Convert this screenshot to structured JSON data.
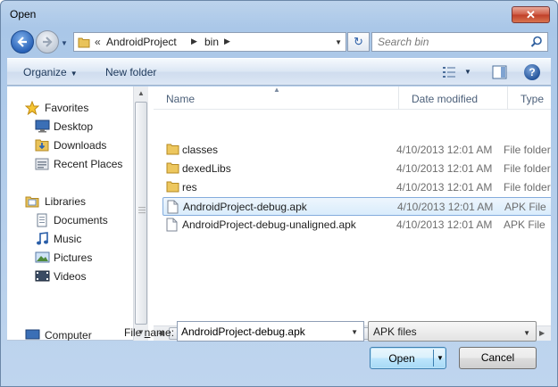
{
  "window": {
    "title": "Open",
    "close_glyph": "✕"
  },
  "address": {
    "overflow": "«",
    "crumbs": [
      "AndroidProject",
      "bin"
    ],
    "separator": "▶",
    "refresh_glyph": "↻"
  },
  "search": {
    "placeholder": "Search bin"
  },
  "toolbar": {
    "organize": "Organize",
    "new_folder": "New folder",
    "help": "?"
  },
  "nav": {
    "favorites": "Favorites",
    "desktop": "Desktop",
    "downloads": "Downloads",
    "recent_places": "Recent Places",
    "libraries": "Libraries",
    "documents": "Documents",
    "music": "Music",
    "pictures": "Pictures",
    "videos": "Videos",
    "computer": "Computer"
  },
  "columns": {
    "name": "Name",
    "date": "Date modified",
    "type": "Type"
  },
  "files": [
    {
      "name": "classes",
      "date": "4/10/2013 12:01 AM",
      "type": "File folder",
      "kind": "folder-icon"
    },
    {
      "name": "dexedLibs",
      "date": "4/10/2013 12:01 AM",
      "type": "File folder",
      "kind": "folder-icon"
    },
    {
      "name": "res",
      "date": "4/10/2013 12:01 AM",
      "type": "File folder",
      "kind": "folder-icon"
    },
    {
      "name": "AndroidProject-debug.apk",
      "date": "4/10/2013 12:01 AM",
      "type": "APK File",
      "kind": "file-icon",
      "selected": true
    },
    {
      "name": "AndroidProject-debug-unaligned.apk",
      "date": "4/10/2013 12:01 AM",
      "type": "APK File",
      "kind": "file-icon"
    }
  ],
  "bottom": {
    "file_name_label_pre": "File ",
    "file_name_label_key": "n",
    "file_name_label_post": "ame:",
    "file_name_value": "AndroidProject-debug.apk",
    "file_type": "APK files",
    "open": "Open",
    "cancel": "Cancel"
  },
  "colors": {
    "accent": "#3c7fb1",
    "selection": "#d9ecfc",
    "chrome": "#bfd5ee"
  }
}
